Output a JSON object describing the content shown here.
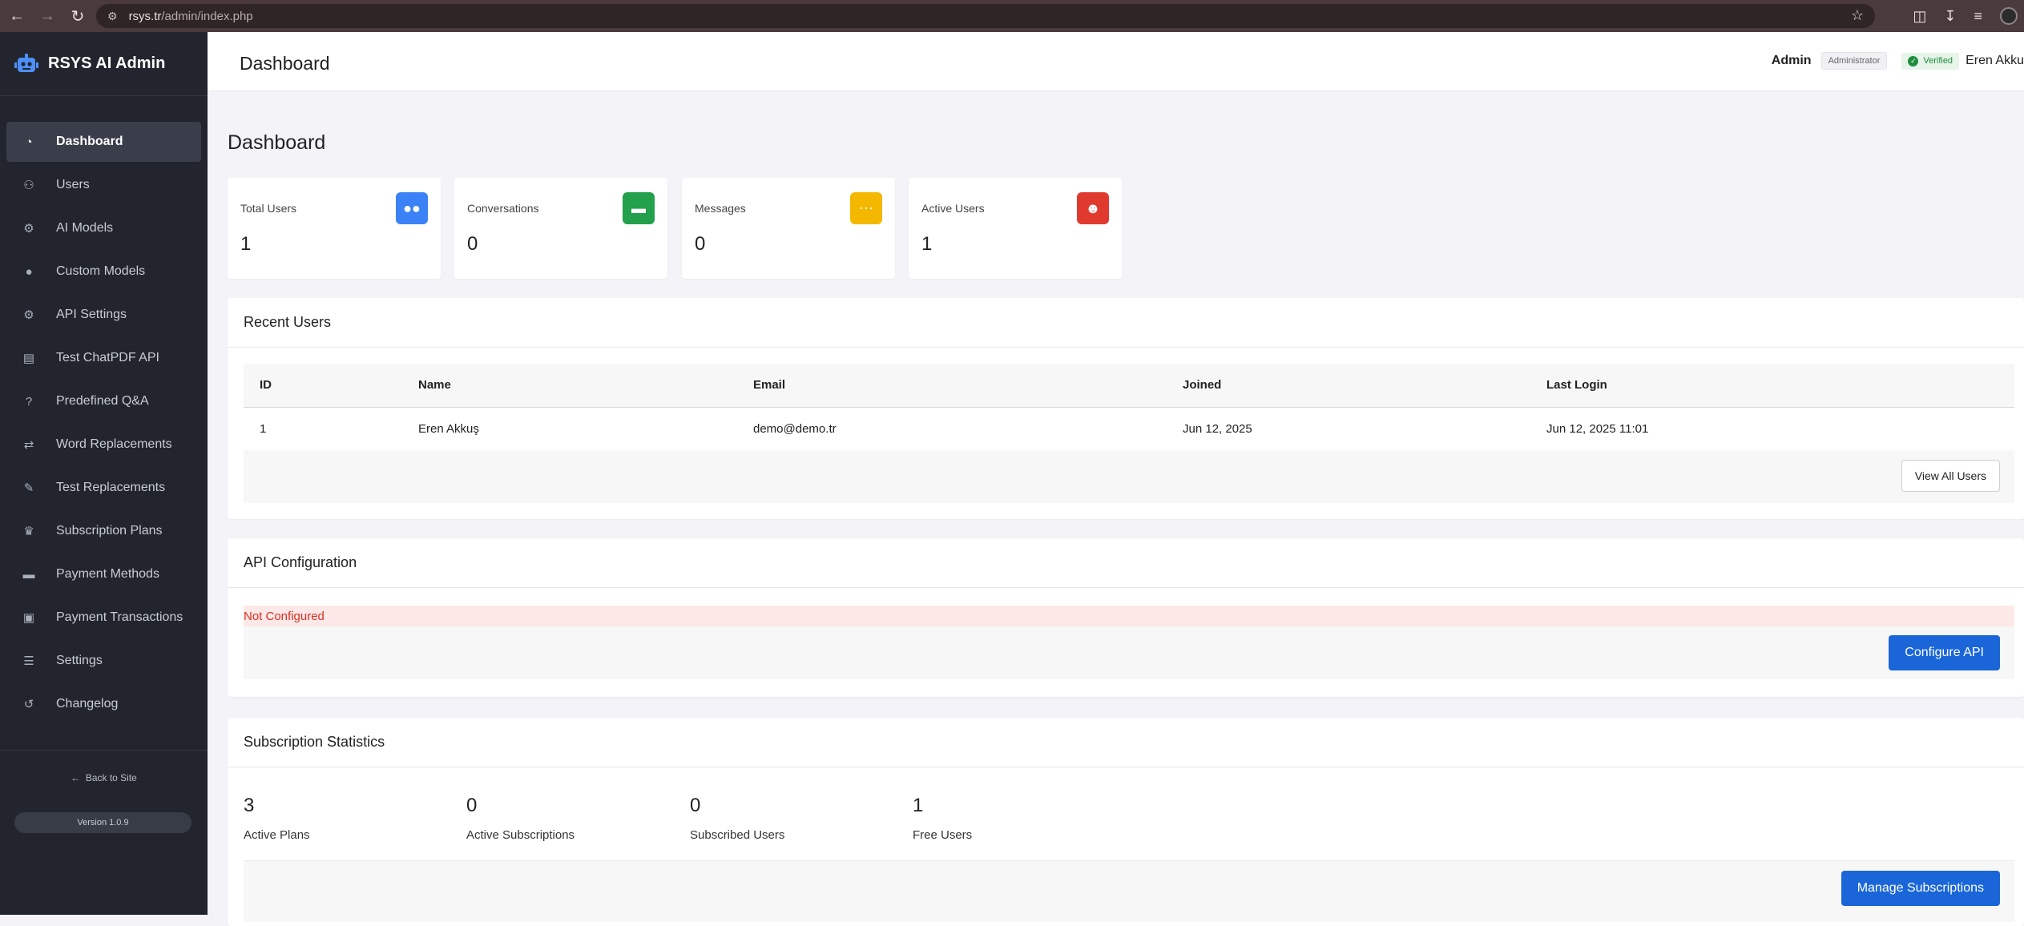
{
  "browser": {
    "url_host": "rsys.tr",
    "url_path": "/admin/index.php"
  },
  "sidebar": {
    "brand": "RSYS AI Admin",
    "items": [
      {
        "label": "Dashboard",
        "icon": "gauge-icon",
        "active": true
      },
      {
        "label": "Users",
        "icon": "users-icon"
      },
      {
        "label": "AI Models",
        "icon": "robot-icon"
      },
      {
        "label": "Custom Models",
        "icon": "brain-icon"
      },
      {
        "label": "API Settings",
        "icon": "cogs-icon"
      },
      {
        "label": "Test ChatPDF API",
        "icon": "file-pdf-icon"
      },
      {
        "label": "Predefined Q&A",
        "icon": "question-circle-icon"
      },
      {
        "label": "Word Replacements",
        "icon": "exchange-icon"
      },
      {
        "label": "Test Replacements",
        "icon": "pencil-icon"
      },
      {
        "label": "Subscription Plans",
        "icon": "crown-icon"
      },
      {
        "label": "Payment Methods",
        "icon": "credit-card-icon"
      },
      {
        "label": "Payment Transactions",
        "icon": "money-transfer-icon"
      },
      {
        "label": "Settings",
        "icon": "sliders-icon"
      },
      {
        "label": "Changelog",
        "icon": "history-icon"
      }
    ],
    "back_link": "Back to Site",
    "version": "Version 1.0.9"
  },
  "header": {
    "title": "Dashboard",
    "user": "Admin",
    "role": "Administrator",
    "verified": "Verified",
    "account_name": "Eren Akku"
  },
  "main": {
    "heading": "Dashboard",
    "stats": [
      {
        "label": "Total Users",
        "value": "1",
        "icon": "users-icon",
        "color": "#3b82f6"
      },
      {
        "label": "Conversations",
        "value": "0",
        "icon": "comments-icon",
        "color": "#22a04b"
      },
      {
        "label": "Messages",
        "value": "0",
        "icon": "comment-dots-icon",
        "color": "#f5b800"
      },
      {
        "label": "Active Users",
        "value": "1",
        "icon": "user-check-icon",
        "color": "#e03a2f"
      }
    ],
    "recent_users": {
      "title": "Recent Users",
      "columns": [
        "ID",
        "Name",
        "Email",
        "Joined",
        "Last Login"
      ],
      "rows": [
        [
          "1",
          "Eren Akkuş",
          "demo@demo.tr",
          "Jun 12, 2025",
          "Jun 12, 2025 11:01"
        ]
      ],
      "button": "View All Users"
    },
    "api_config": {
      "title": "API Configuration",
      "status": "Not Configured",
      "button": "Configure API"
    },
    "subscription_stats": {
      "title": "Subscription Statistics",
      "stats": [
        {
          "value": "3",
          "label": "Active Plans"
        },
        {
          "value": "0",
          "label": "Active Subscriptions"
        },
        {
          "value": "0",
          "label": "Subscribed Users"
        },
        {
          "value": "1",
          "label": "Free Users"
        }
      ],
      "button": "Manage Subscriptions"
    }
  }
}
